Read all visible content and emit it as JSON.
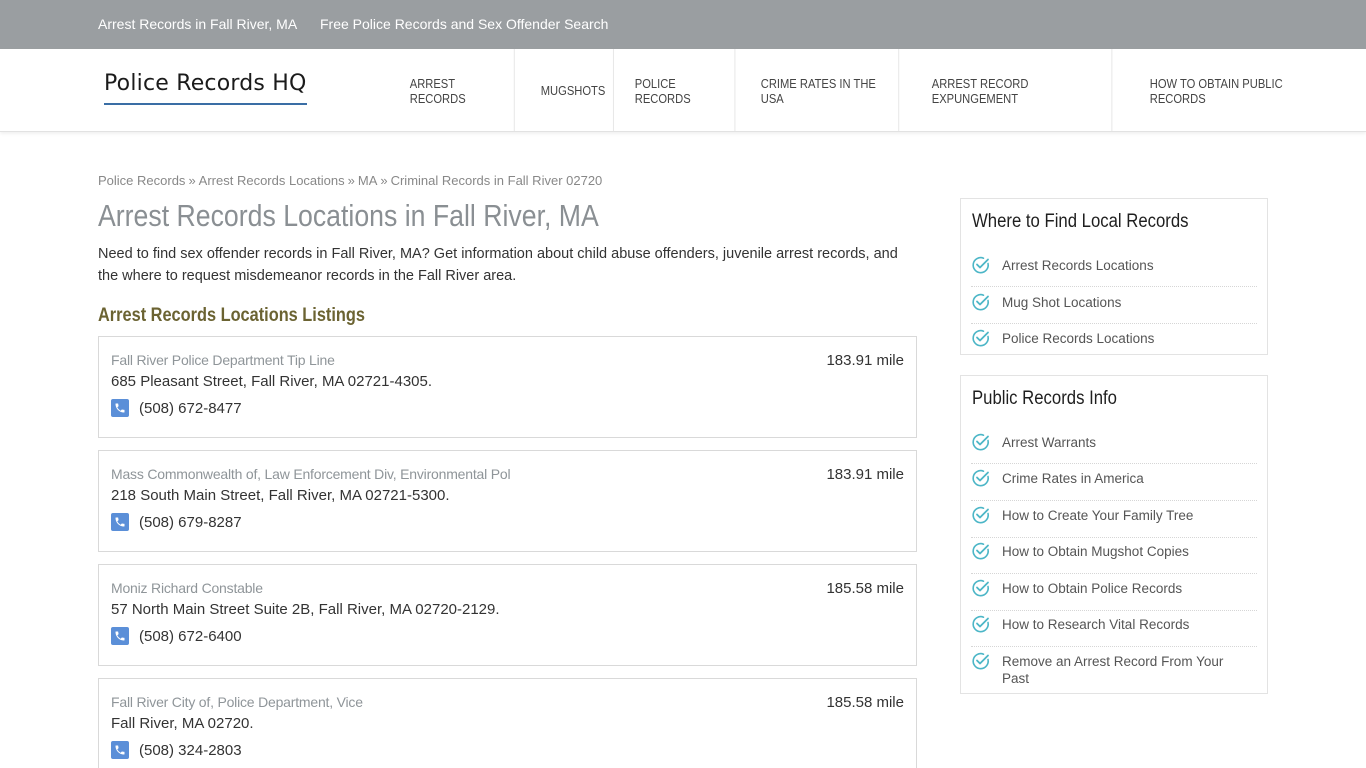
{
  "topbar": {
    "links": [
      "Arrest Records in Fall River, MA",
      "Free Police Records and Sex Offender Search"
    ]
  },
  "header": {
    "logo": "Police Records HQ",
    "nav": [
      "Arrest Records",
      "Mugshots",
      "Police Records",
      "Crime Rates in the USA",
      "Arrest Record Expungement",
      "How to Obtain Public Records"
    ]
  },
  "breadcrumb": [
    "Police Records",
    "Arrest Records Locations",
    "MA",
    "Criminal Records in Fall River 02720"
  ],
  "main": {
    "title": "Arrest Records Locations in Fall River, MA",
    "intro": "Need to find sex offender records in Fall River, MA? Get information about child abuse offenders, juvenile arrest records, and the where to request misdemeanor records in the Fall River area.",
    "section_title": "Arrest Records Locations Listings",
    "listings": [
      {
        "name": "Fall River Police Department Tip Line",
        "address": "685 Pleasant Street, Fall River, MA 02721-4305.",
        "phone": "(508) 672-8477",
        "distance": "183.91 mile"
      },
      {
        "name": "Mass Commonwealth of, Law Enforcement Div, Environmental Pol",
        "address": "218 South Main Street, Fall River, MA 02721-5300.",
        "phone": "(508) 679-8287",
        "distance": "183.91 mile"
      },
      {
        "name": "Moniz Richard Constable",
        "address": "57 North Main Street Suite 2B, Fall River, MA 02720-2129.",
        "phone": "(508) 672-6400",
        "distance": "185.58 mile"
      },
      {
        "name": "Fall River City of, Police Department, Vice",
        "address": "Fall River, MA 02720.",
        "phone": "(508) 324-2803",
        "distance": "185.58 mile"
      }
    ]
  },
  "sidebar": {
    "local": {
      "title": "Where to Find Local Records",
      "items": [
        "Arrest Records Locations",
        "Mug Shot Locations",
        "Police Records Locations"
      ]
    },
    "info": {
      "title": "Public Records Info",
      "items": [
        "Arrest Warrants",
        "Crime Rates in America",
        "How to Create Your Family Tree",
        "How to Obtain Mugshot Copies",
        "How to Obtain Police Records",
        "How to Research Vital Records",
        "Remove an Arrest Record From Your Past"
      ]
    }
  },
  "colors": {
    "topbar": "#9a9ea1",
    "accent_check": "#4cb6c7",
    "phone_icon": "#5b8fd8",
    "section_title": "#6b6332"
  }
}
